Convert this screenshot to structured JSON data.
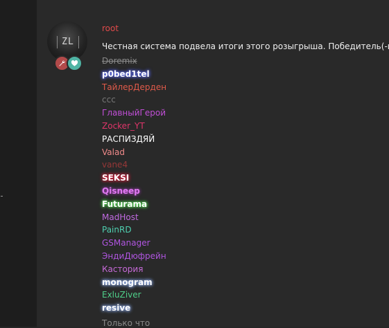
{
  "post": {
    "author": "root",
    "message": "Честная система подвела итоги этого розыгрыша. Победитель(-и):",
    "time": "Только что",
    "avatar_text": "ZL"
  },
  "winners": [
    {
      "name": "Doremix",
      "color": "#8a8a8a",
      "style": "strike"
    },
    {
      "name": "p0bed1tel",
      "color": "#ffffff",
      "style": "glow-blue"
    },
    {
      "name": "ТайлерДерден",
      "color": "#e05a4a",
      "style": "plain"
    },
    {
      "name": "ccc",
      "color": "#777777",
      "style": "plain"
    },
    {
      "name": "ГлавныйГерой",
      "color": "#c24fd8",
      "style": "plain"
    },
    {
      "name": "Zocker_YT",
      "color": "#e0356a",
      "style": "plain"
    },
    {
      "name": "РАСПИЗДЯЙ",
      "color": "#ffffff",
      "style": "plain"
    },
    {
      "name": "Valad",
      "color": "#f08a8a",
      "style": "plain"
    },
    {
      "name": "vane4",
      "color": "#a83a3a",
      "style": "dim"
    },
    {
      "name": "SEKSI",
      "color": "#ffffff",
      "style": "glow-red"
    },
    {
      "name": "Qisneep",
      "color": "#e07af0",
      "style": "glow-pink"
    },
    {
      "name": "Futurama",
      "color": "#ffffff",
      "style": "glow-green"
    },
    {
      "name": "MadHost",
      "color": "#c06ae0",
      "style": "plain"
    },
    {
      "name": "PainRD",
      "color": "#4fd0b0",
      "style": "plain"
    },
    {
      "name": "GSManager",
      "color": "#b055e0",
      "style": "plain"
    },
    {
      "name": "ЭндиДюфрейн",
      "color": "#b055e0",
      "style": "plain"
    },
    {
      "name": "Кастория",
      "color": "#c76ad8",
      "style": "plain"
    },
    {
      "name": "monogram",
      "color": "#ffffff",
      "style": "glow-white"
    },
    {
      "name": "ExluZiver",
      "color": "#4fd08a",
      "style": "plain"
    },
    {
      "name": "resive",
      "color": "#ffffff",
      "style": "glow-white"
    }
  ],
  "icons": {
    "tool": "wrench-icon",
    "heart": "heart-icon"
  }
}
